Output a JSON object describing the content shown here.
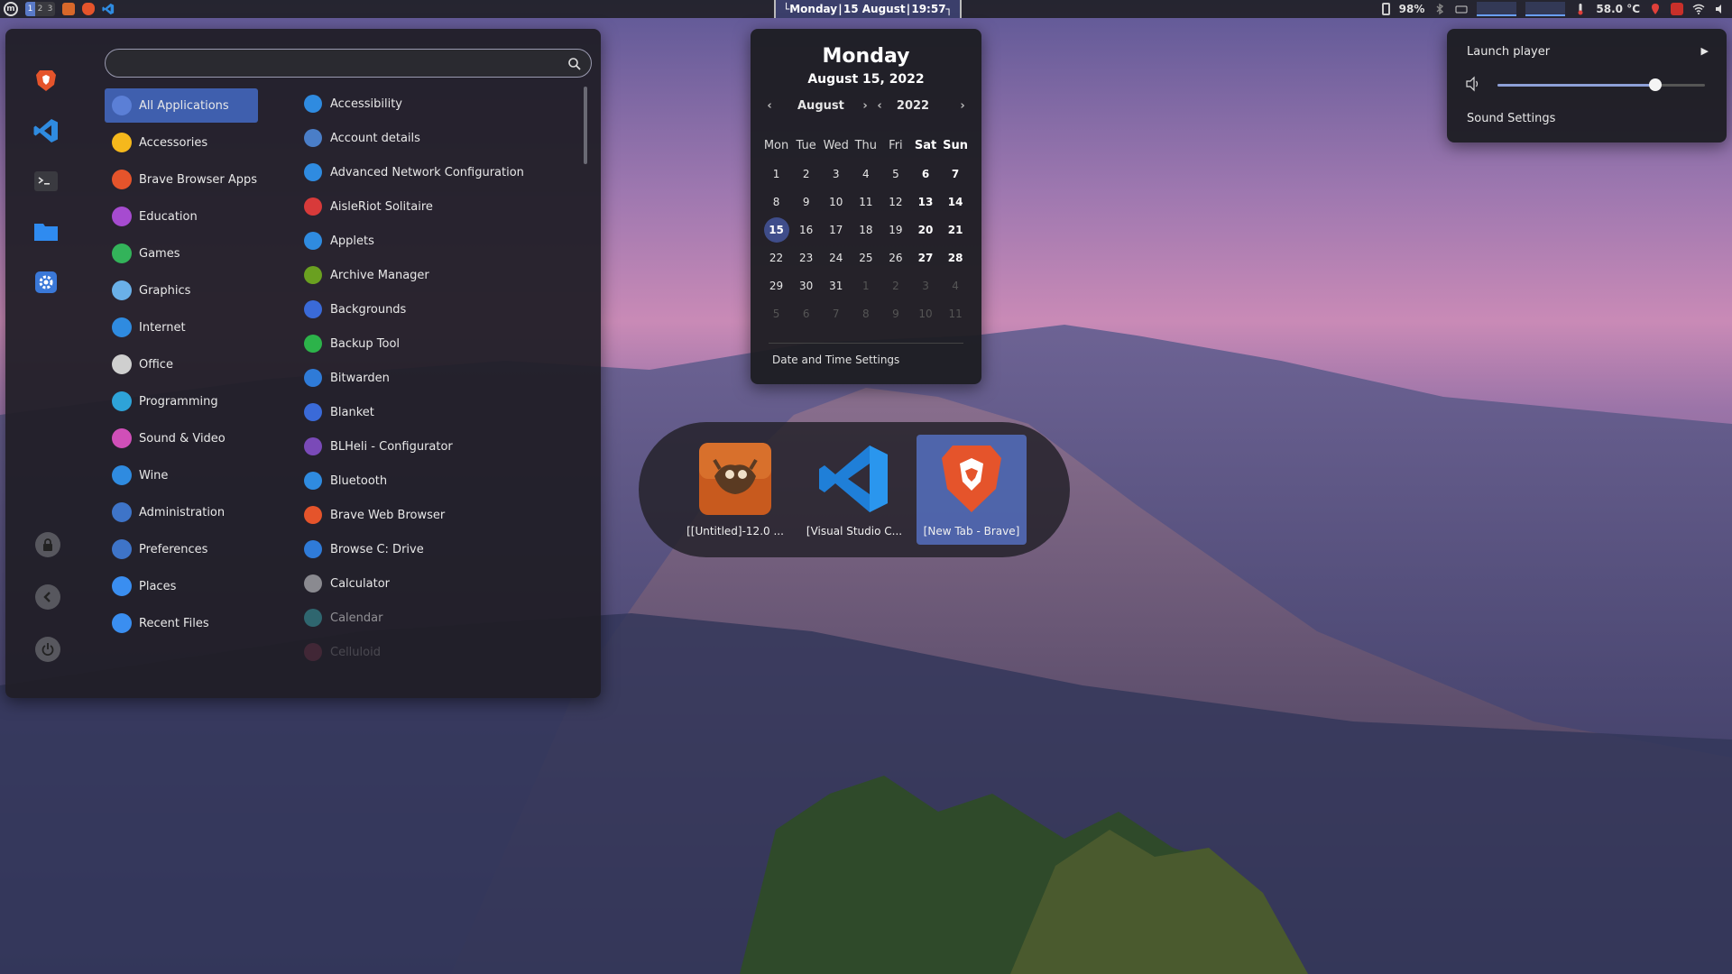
{
  "panel": {
    "workspaces": [
      "1",
      "2",
      "3"
    ],
    "clock": "└Monday | 15 August | 19:57┐",
    "battery": "98%",
    "temperature": "58.0 °C"
  },
  "menu": {
    "search": {
      "value": "",
      "placeholder": ""
    },
    "categories": [
      {
        "label": "All Applications",
        "icon": "grid-icon",
        "color": "#5b7fd6"
      },
      {
        "label": "Accessories",
        "icon": "wrench-icon",
        "color": "#f5b81c"
      },
      {
        "label": "Brave Browser Apps",
        "icon": "brave-icon",
        "color": "#e5542b"
      },
      {
        "label": "Education",
        "icon": "education-icon",
        "color": "#a64bd0"
      },
      {
        "label": "Games",
        "icon": "gamepad-icon",
        "color": "#33b35a"
      },
      {
        "label": "Graphics",
        "icon": "graphics-icon",
        "color": "#6ab0e8"
      },
      {
        "label": "Internet",
        "icon": "globe-icon",
        "color": "#2f8be0"
      },
      {
        "label": "Office",
        "icon": "office-icon",
        "color": "#cfcfcf"
      },
      {
        "label": "Programming",
        "icon": "code-icon",
        "color": "#2ea3d8"
      },
      {
        "label": "Sound & Video",
        "icon": "music-icon",
        "color": "#d04fb8"
      },
      {
        "label": "Wine",
        "icon": "windows-icon",
        "color": "#2f8be0"
      },
      {
        "label": "Administration",
        "icon": "admin-icon",
        "color": "#3e74c8"
      },
      {
        "label": "Preferences",
        "icon": "gear-icon",
        "color": "#3e74c8"
      },
      {
        "label": "Places",
        "icon": "folder-icon",
        "color": "#3a8ef0"
      },
      {
        "label": "Recent Files",
        "icon": "clock-icon",
        "color": "#3a8ef0"
      }
    ],
    "apps": [
      {
        "label": "Accessibility",
        "icon": "accessibility-icon",
        "color": "#2f8be0"
      },
      {
        "label": "Account details",
        "icon": "user-icon",
        "color": "#4a7ec8"
      },
      {
        "label": "Advanced Network Configuration",
        "icon": "network-icon",
        "color": "#2f8be0"
      },
      {
        "label": "AisleRiot Solitaire",
        "icon": "cards-icon",
        "color": "#d83a3a"
      },
      {
        "label": "Applets",
        "icon": "applets-icon",
        "color": "#2f8be0"
      },
      {
        "label": "Archive Manager",
        "icon": "archive-icon",
        "color": "#6aa020"
      },
      {
        "label": "Backgrounds",
        "icon": "image-icon",
        "color": "#3a6ad8"
      },
      {
        "label": "Backup Tool",
        "icon": "backup-icon",
        "color": "#2cb34a"
      },
      {
        "label": "Bitwarden",
        "icon": "shield-icon",
        "color": "#2f7bd8"
      },
      {
        "label": "Blanket",
        "icon": "blanket-icon",
        "color": "#3a6ad8"
      },
      {
        "label": "BLHeli - Configurator",
        "icon": "blheli-icon",
        "color": "#7a4ab8"
      },
      {
        "label": "Bluetooth",
        "icon": "bluetooth-icon",
        "color": "#2f8be0"
      },
      {
        "label": "Brave Web Browser",
        "icon": "brave-icon",
        "color": "#e5542b"
      },
      {
        "label": "Browse C: Drive",
        "icon": "drive-icon",
        "color": "#2f7bd8"
      },
      {
        "label": "Calculator",
        "icon": "calculator-icon",
        "color": "#8a8a90"
      },
      {
        "label": "Calendar",
        "icon": "calendar-icon",
        "color": "#3aa0a8"
      },
      {
        "label": "Celluloid",
        "icon": "celluloid-icon",
        "color": "#c04a6a"
      }
    ]
  },
  "calendar": {
    "day": "Monday",
    "date": "August 15, 2022",
    "month": "August",
    "year": "2022",
    "weekdays": [
      "Mon",
      "Tue",
      "Wed",
      "Thu",
      "Fri",
      "Sat",
      "Sun"
    ],
    "weeks": [
      [
        "1",
        "2",
        "3",
        "4",
        "5",
        "6",
        "7"
      ],
      [
        "8",
        "9",
        "10",
        "11",
        "12",
        "13",
        "14"
      ],
      [
        "15",
        "16",
        "17",
        "18",
        "19",
        "20",
        "21"
      ],
      [
        "22",
        "23",
        "24",
        "25",
        "26",
        "27",
        "28"
      ],
      [
        "29",
        "30",
        "31",
        "1",
        "2",
        "3",
        "4"
      ],
      [
        "5",
        "6",
        "7",
        "8",
        "9",
        "10",
        "11"
      ]
    ],
    "today": "15",
    "settings_label": "Date and Time Settings"
  },
  "switcher": {
    "items": [
      {
        "label": "[[Untitled]-12.0 ...",
        "icon": "gimp-icon"
      },
      {
        "label": "[Visual Studio C...",
        "icon": "vscode-icon"
      },
      {
        "label": "[New Tab - Brave]",
        "icon": "brave-icon"
      }
    ]
  },
  "sound": {
    "launch_player": "Launch player",
    "volume_fraction": 0.76,
    "settings_label": "Sound Settings"
  },
  "colors": {
    "accent": "#3f5fae",
    "today": "#3f4d8a"
  }
}
